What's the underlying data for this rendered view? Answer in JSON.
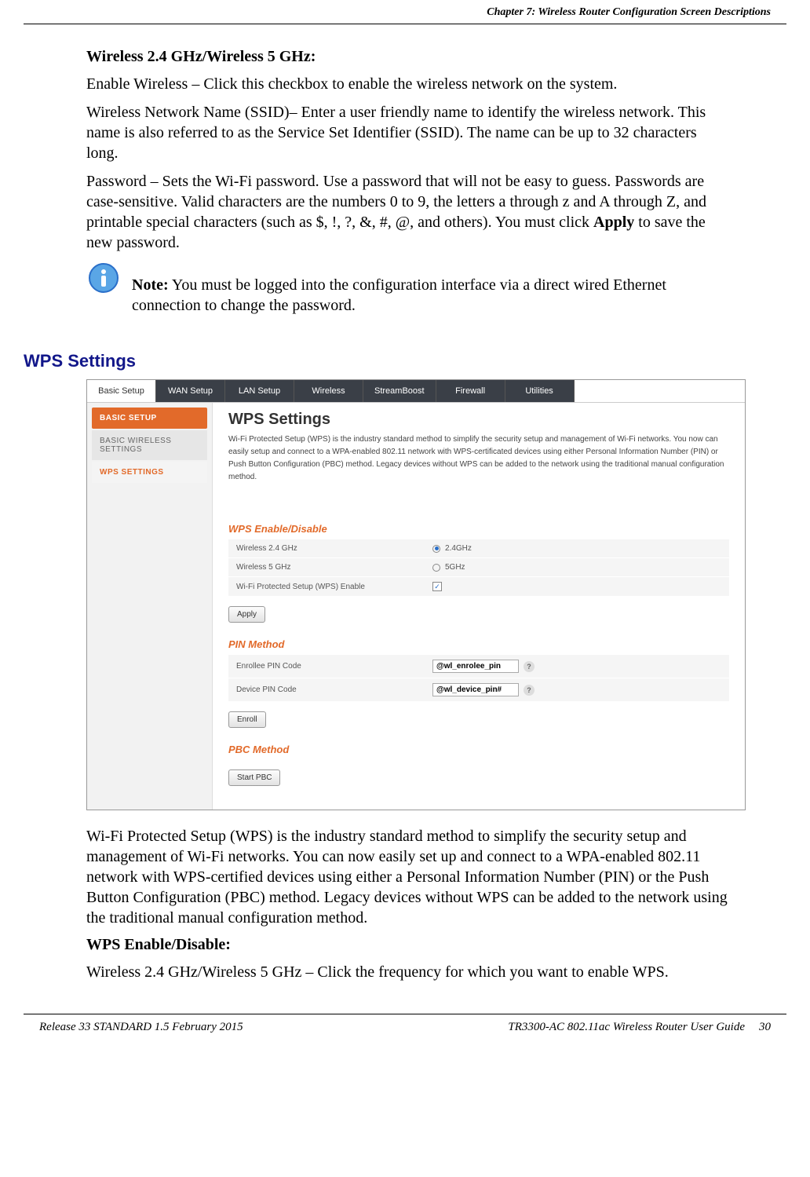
{
  "header": {
    "chapter": "Chapter 7: Wireless Router Configuration Screen Descriptions"
  },
  "doc": {
    "heading1": "Wireless 2.4 GHz/Wireless 5 GHz:",
    "p1": "Enable Wireless – Click this checkbox to enable the wireless network on the system.",
    "p2": "Wireless Network Name (SSID)– Enter a user friendly name to identify the wireless network. This name is also referred to as the Service Set Identifier (SSID). The name can be up to 32 characters long.",
    "p3_a": "Password – Sets the Wi-Fi password. Use a password that will not be easy to guess. Passwords are case-sensitive. Valid characters are the numbers 0 to 9, the letters a through z and A through Z, and printable special characters (such as $, !, ?, &, #, @, and others). You must click ",
    "p3_b": "Apply",
    "p3_c": " to save the new password.",
    "note_label": "Note:",
    "note_text": "  You must be logged into the configuration interface via a direct wired Ethernet connection to change the password.",
    "wps_heading": "WPS Settings",
    "wps_desc": "Wi-Fi Protected Setup (WPS) is the industry standard method to simplify the security setup and management of Wi-Fi networks. You can now easily set up and connect to a WPA-enabled 802.11 network with WPS-certified devices using either a Personal Information Number (PIN) or the Push Button Configuration (PBC) method. Legacy devices without WPS can be added to the network using the traditional manual configuration method.",
    "heading2": "WPS Enable/Disable:",
    "p4": "Wireless 2.4 GHz/Wireless 5 GHz – Click the frequency for which you want to enable WPS."
  },
  "ui": {
    "tabs": [
      "Basic Setup",
      "WAN Setup",
      "LAN Setup",
      "Wireless",
      "StreamBoost",
      "Firewall",
      "Utilities"
    ],
    "sidebar": {
      "head": "BASIC SETUP",
      "item1": "BASIC WIRELESS SETTINGS",
      "item2": "WPS SETTINGS"
    },
    "panel": {
      "title": "WPS Settings",
      "desc": "Wi-Fi Protected Setup (WPS) is the industry standard method to simplify the security setup and management of Wi-Fi networks. You now can easily setup and connect to a WPA-enabled 802.11 network with WPS-certificated devices using either Personal Information Number (PIN) or Push Button Configuration (PBC) method. Legacy devices without WPS can be added to the network using the traditional manual configuration method.",
      "sec1": "WPS Enable/Disable",
      "row1_label": "Wireless 2.4 GHz",
      "row1_val": "2.4GHz",
      "row2_label": "Wireless 5 GHz",
      "row2_val": "5GHz",
      "row3_label": "Wi-Fi Protected Setup (WPS) Enable",
      "btn_apply": "Apply",
      "sec2": "PIN Method",
      "row4_label": "Enrollee PIN Code",
      "row4_val": "@wl_enrolee_pin",
      "row5_label": "Device PIN Code",
      "row5_val": "@wl_device_pin#",
      "btn_enroll": "Enroll",
      "sec3": "PBC Method",
      "btn_pbc": "Start PBC",
      "help": "?"
    }
  },
  "footer": {
    "left": "Release 33 STANDARD 1.5    February 2015",
    "right_title": "TR3300-AC 802.11ac Wireless Router User Guide",
    "page": "30"
  }
}
